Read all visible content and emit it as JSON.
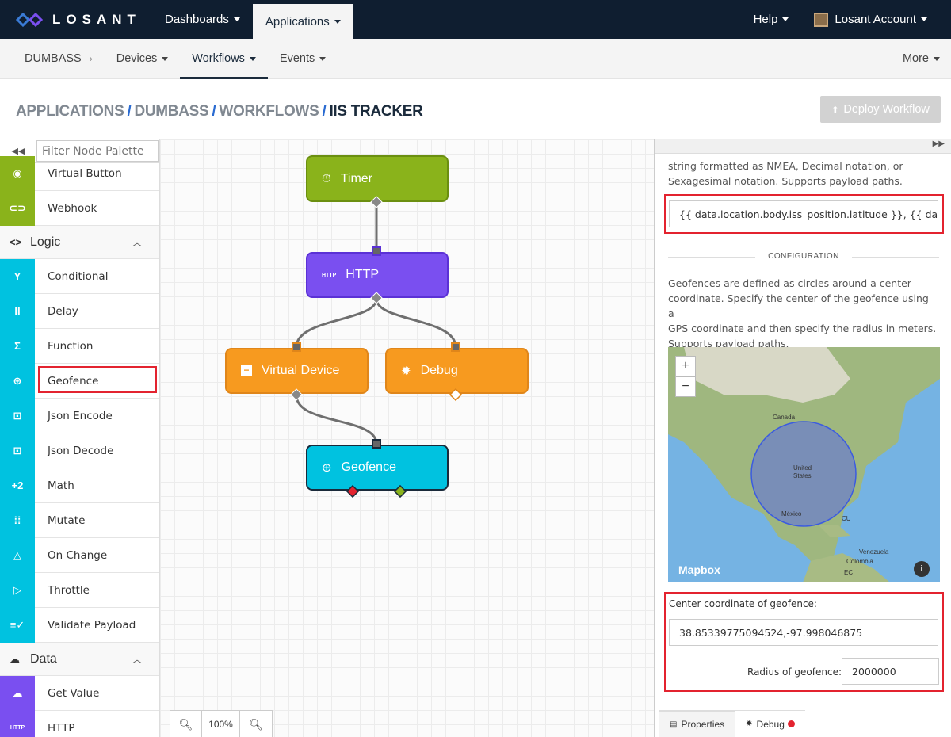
{
  "topnav": {
    "brand": "LOSANT",
    "items": [
      "Dashboards",
      "Applications"
    ],
    "help": "Help",
    "account": "Losant Account"
  },
  "subnav": {
    "app": "DUMBASS",
    "items": [
      "Devices",
      "Workflows",
      "Events"
    ],
    "more": "More"
  },
  "breadcrumb": [
    "APPLICATIONS",
    "DUMBASS",
    "WORKFLOWS",
    "IIS TRACKER"
  ],
  "deploy_label": "Deploy Workflow",
  "palette": {
    "filter_placeholder": "Filter Node Palette",
    "top_items": [
      {
        "label": "Virtual Button",
        "icon": "◉"
      },
      {
        "label": "Webhook",
        "icon": "⊂⊃"
      }
    ],
    "logic_title": "Logic",
    "logic_icon": "<>",
    "logic_items": [
      {
        "label": "Conditional",
        "icon": "Y"
      },
      {
        "label": "Delay",
        "icon": "II"
      },
      {
        "label": "Function",
        "icon": "Σ"
      },
      {
        "label": "Geofence",
        "icon": "⊕"
      },
      {
        "label": "Json Encode",
        "icon": "⊡"
      },
      {
        "label": "Json Decode",
        "icon": "⊡"
      },
      {
        "label": "Math",
        "icon": "+2"
      },
      {
        "label": "Mutate",
        "icon": "⁞⁞"
      },
      {
        "label": "On Change",
        "icon": "△"
      },
      {
        "label": "Throttle",
        "icon": "▷"
      },
      {
        "label": "Validate Payload",
        "icon": "≡✓"
      }
    ],
    "data_title": "Data",
    "data_items": [
      {
        "label": "Get Value",
        "icon": "☁"
      },
      {
        "label": "HTTP",
        "icon": "HTTP"
      }
    ]
  },
  "nodes": {
    "timer": "Timer",
    "http": "HTTP",
    "http_badge": "HTTP",
    "virtual_device": "Virtual Device",
    "debug": "Debug",
    "geofence": "Geofence"
  },
  "zoom": "100%",
  "panel": {
    "desc1a": "string formatted as NMEA, Decimal notation, or",
    "desc1b": "Sexagesimal notation. Supports payload paths.",
    "location_value": "{{ data.location.body.iss_position.latitude }}, {{ da",
    "config_title": "CONFIGURATION",
    "desc2": [
      "Geofences are defined as circles around a center",
      "coordinate. Specify the center of the geofence using a",
      "GPS coordinate and then specify the radius in meters.",
      "Supports payload paths."
    ],
    "map_labels": {
      "canada": "Canada",
      "us1": "United",
      "us2": "States",
      "mexico": "México",
      "cu": "CU",
      "venezuela": "Venezuela",
      "colombia": "Colombia",
      "ec": "EC",
      "brand": "Mapbox"
    },
    "center_label": "Center coordinate of geofence:",
    "center_value": "38.85339775094524,-97.998046875",
    "radius_label": "Radius of geofence:",
    "radius_value": "2000000",
    "tabs": [
      "Properties",
      "Debug"
    ]
  },
  "colors": {
    "timer": "#8ab31b",
    "http": "#7a4ff0",
    "orange": "#f79a1f",
    "geofence": "#00c2e0",
    "nav": "#0f1e30"
  }
}
